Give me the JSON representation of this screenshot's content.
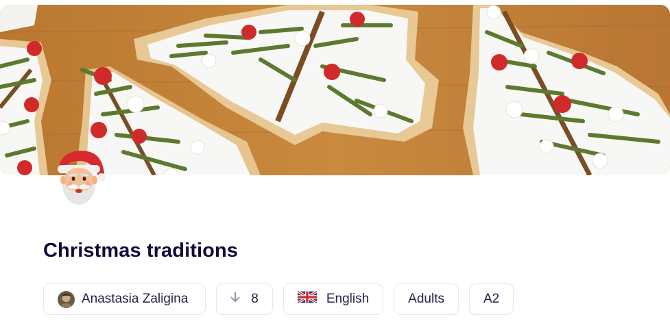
{
  "lesson": {
    "title": "Christmas traditions",
    "cover_image": "christmas-tree-cookies-photo",
    "emoji": "santa-claus"
  },
  "meta": {
    "author": "Anastasia Zaligina",
    "downloads": "8",
    "language": "English",
    "language_flag": "uk-flag-icon",
    "audience": "Adults",
    "level": "A2"
  },
  "colors": {
    "title": "#0f0c3b",
    "chip_border": "#e6e7ec",
    "chip_text": "#22224a"
  }
}
